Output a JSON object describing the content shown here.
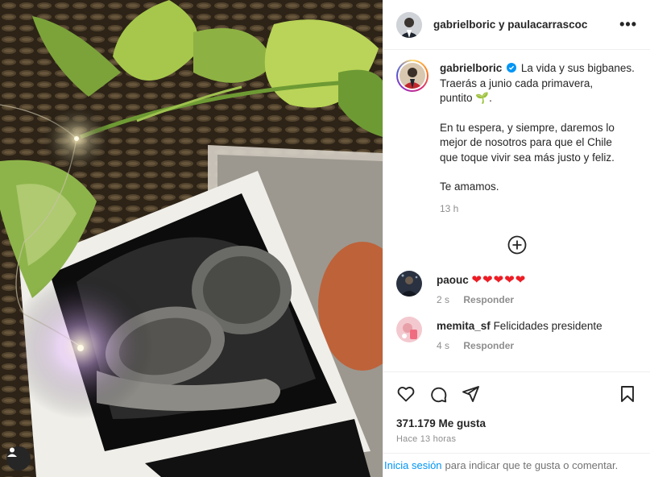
{
  "header": {
    "title": "gabrielboric y paulacarrascoc",
    "more_label": "•••"
  },
  "caption": {
    "username": "gabrielboric",
    "lines": [
      "La vida y sus bigbanes.",
      "Traerás a junio cada primavera,",
      "puntito 🌱."
    ],
    "paragraph2": [
      "En tu espera, y siempre, daremos lo",
      "mejor de nosotros para que el Chile",
      "que toque vivir sea más justo y feliz."
    ],
    "paragraph3": "Te amamos.",
    "time": "13 h"
  },
  "comments": [
    {
      "username": "paouc",
      "text": "❤❤❤❤❤",
      "time": "2 s",
      "reply": "Responder"
    },
    {
      "username": "memita_sf",
      "text": "Felicidades presidente",
      "time": "4 s",
      "reply": "Responder"
    }
  ],
  "actions": {
    "likes": "371.179 Me gusta",
    "ago": "Hace 13 horas"
  },
  "login": {
    "link": "Inicia sesión",
    "text": "para indicar que te gusta o comentar."
  },
  "colors": {
    "link": "#0095f6",
    "verified": "#0095f6",
    "muted": "#8e8e8e",
    "heart": "#ed1c24"
  }
}
